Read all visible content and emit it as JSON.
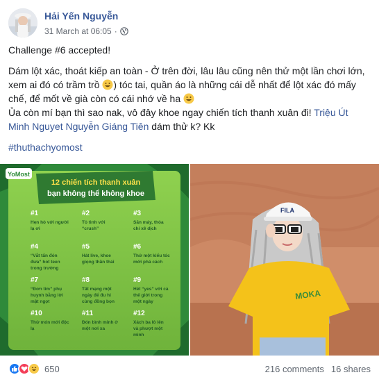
{
  "post": {
    "author": "Hải Yến Nguyễn",
    "timestamp": "31 March at 06:05",
    "separator": "·",
    "privacy_icon": "globe-icon",
    "paragraph1": "Challenge #6 accepted!",
    "paragraph2_part1": "Dám lột xác, thoát kiếp an toàn - Ở trên đời, lâu lâu cũng nên thử một lần chơi lớn, xem ai đó có trầm trồ ",
    "paragraph2_part2": ") tóc tai, quần áo là những cái dễ nhất để lột xác đó mấy chế, để mốt về già còn có cái nhớ về ha ",
    "paragraph3_part1": "Ủa còn mí bạn thì sao nak, vô đây khoe ngay chiến tích thanh xuân đi! ",
    "mention1": "Triệu Út Minh",
    "mention2": "Nguyet Nguyễn",
    "mention3": "Giáng Tiên",
    "paragraph3_part2": " dám thử k? Kk",
    "hashtag": "#thuthachyomost"
  },
  "poster": {
    "brand": "YoMost",
    "title_line1": "12 chiến tích thanh xuân",
    "title_line2": "bạn không thể không khoe",
    "items": [
      {
        "num": "#1",
        "text": "Hẹn hò với người lạ ơi"
      },
      {
        "num": "#2",
        "text": "Tỏ tình với “crush”"
      },
      {
        "num": "#3",
        "text": "Săn máy, thỏa chí xê dịch"
      },
      {
        "num": "#4",
        "text": "“Vắt tấn đón đưa” hot teen trong trường"
      },
      {
        "num": "#5",
        "text": "Hát live, khoe giọng thần thái"
      },
      {
        "num": "#6",
        "text": "Thử một kiểu tóc mới phá cách"
      },
      {
        "num": "#7",
        "text": "“Đơn tim” phụ huynh bằng lời mật ngọt"
      },
      {
        "num": "#8",
        "text": "Tất mạng một ngày để đu hi cùng đồng bọn"
      },
      {
        "num": "#9",
        "text": "Hét “yes” với cả thế giới trong một ngày"
      },
      {
        "num": "#10",
        "text": "Thử món mới độc lạ"
      },
      {
        "num": "#11",
        "text": "Đón bình minh ở một nơi xa"
      },
      {
        "num": "#12",
        "text": "Xách ba lô lên và phượt một mình"
      }
    ]
  },
  "photo": {
    "cap_text": "FILA"
  },
  "footer": {
    "reaction_icons": [
      "like-icon",
      "love-icon",
      "haha-icon"
    ],
    "reaction_count": "650",
    "comments": "216 comments",
    "shares": "16 shares"
  },
  "colors": {
    "link": "#385898",
    "poster_green": "#7cc242",
    "poster_dark": "#1f6b2d",
    "photo_yellow": "#f4c21a",
    "wall": "#c98a6a"
  }
}
